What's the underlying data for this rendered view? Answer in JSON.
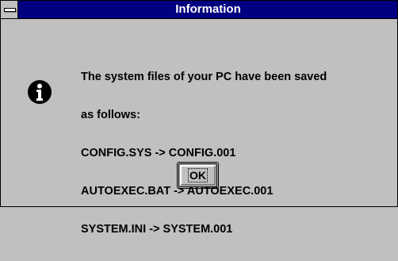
{
  "window": {
    "title": "Information"
  },
  "icon": "information-icon",
  "message": {
    "lines": [
      "The system files of your PC have been saved",
      "as follows:",
      "CONFIG.SYS -> CONFIG.001",
      "AUTOEXEC.BAT -> AUTOEXEC.001",
      "SYSTEM.INI -> SYSTEM.001"
    ]
  },
  "buttons": {
    "ok_label": "OK"
  },
  "colors": {
    "titlebar": "#000080",
    "face": "#c0c0c0",
    "text": "#000000"
  }
}
